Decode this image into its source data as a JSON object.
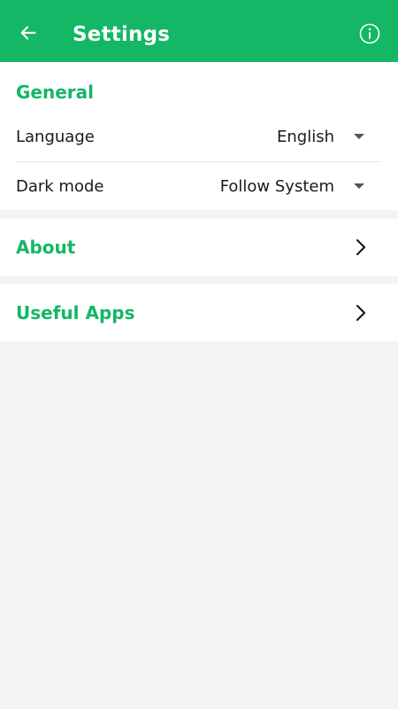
{
  "appbar": {
    "title": "Settings",
    "back_icon": "arrow-left-icon",
    "info_icon": "info-icon"
  },
  "general": {
    "title": "General",
    "language": {
      "label": "Language",
      "value": "English"
    },
    "dark_mode": {
      "label": "Dark mode",
      "value": "Follow System"
    }
  },
  "about": {
    "title": "About"
  },
  "useful_apps": {
    "title": "Useful Apps"
  },
  "colors": {
    "accent": "#13b765",
    "background": "#f4f4f4",
    "card": "#ffffff"
  }
}
